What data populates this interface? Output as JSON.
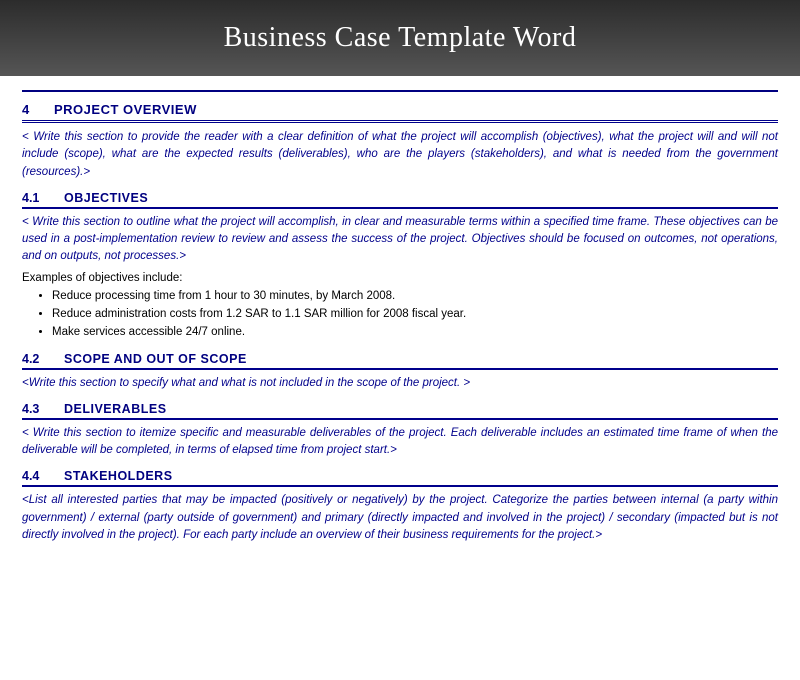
{
  "header": {
    "title": "Business Case Template Word"
  },
  "sections": [
    {
      "number": "4",
      "title": "PROJECT OVERVIEW",
      "description": "< Write this section to provide the reader with a clear definition of what the project will accomplish (objectives), what the project will and will not include (scope), what are the expected results (deliverables), who are the players (stakeholders), and what is needed from the government (resources).>"
    }
  ],
  "subsections": [
    {
      "number": "4.1",
      "title": "OBJECTIVES",
      "description": "< Write this section to outline what the project will accomplish, in clear and measurable terms within a specified time frame.  These objectives can be used in a post-implementation review to review and assess the success of the project.  Objectives should be focused on outcomes, not operations, and on outputs, not processes.>",
      "examples_label": "Examples of objectives include:",
      "bullets": [
        "Reduce processing time from 1 hour to 30 minutes, by March 2008.",
        "Reduce administration costs from 1.2 SAR to 1.1 SAR million for 2008 fiscal year.",
        "Make services accessible 24/7 online."
      ]
    },
    {
      "number": "4.2",
      "title": "SCOPE AND OUT OF SCOPE",
      "description": "<Write this section to specify what and what is not included in the scope of the project. >"
    },
    {
      "number": "4.3",
      "title": "DELIVERABLES",
      "description": "< Write this section to itemize specific and measurable deliverables of the project.  Each deliverable includes an estimated time frame of when the deliverable will be completed, in terms of elapsed time from project start.>"
    },
    {
      "number": "4.4",
      "title": "STAKEHOLDERS",
      "description": "<List all interested parties that may be impacted (positively or negatively) by the project.  Categorize the parties between internal (a party within government) / external (party outside of government) and primary (directly impacted and involved in the project) / secondary (impacted but is not directly involved in the project).  For each party include an overview of their business requirements for the project.>"
    }
  ]
}
